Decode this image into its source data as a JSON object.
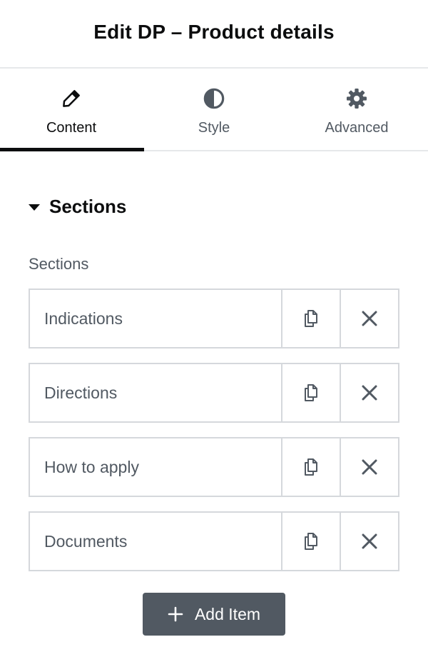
{
  "header": {
    "title": "Edit DP – Product details"
  },
  "tabs": [
    {
      "label": "Content",
      "icon": "pencil-icon",
      "active": true
    },
    {
      "label": "Style",
      "icon": "half-circle-icon",
      "active": false
    },
    {
      "label": "Advanced",
      "icon": "gear-icon",
      "active": false
    }
  ],
  "section": {
    "title": "Sections",
    "field_label": "Sections",
    "items": [
      {
        "title": "Indications"
      },
      {
        "title": "Directions"
      },
      {
        "title": "How to apply"
      },
      {
        "title": "Documents"
      }
    ],
    "add_label": "Add Item"
  },
  "colors": {
    "text_dark": "#0c0d0e",
    "text_muted": "#515962",
    "border": "#d5d8dc",
    "button_bg": "#515962"
  }
}
